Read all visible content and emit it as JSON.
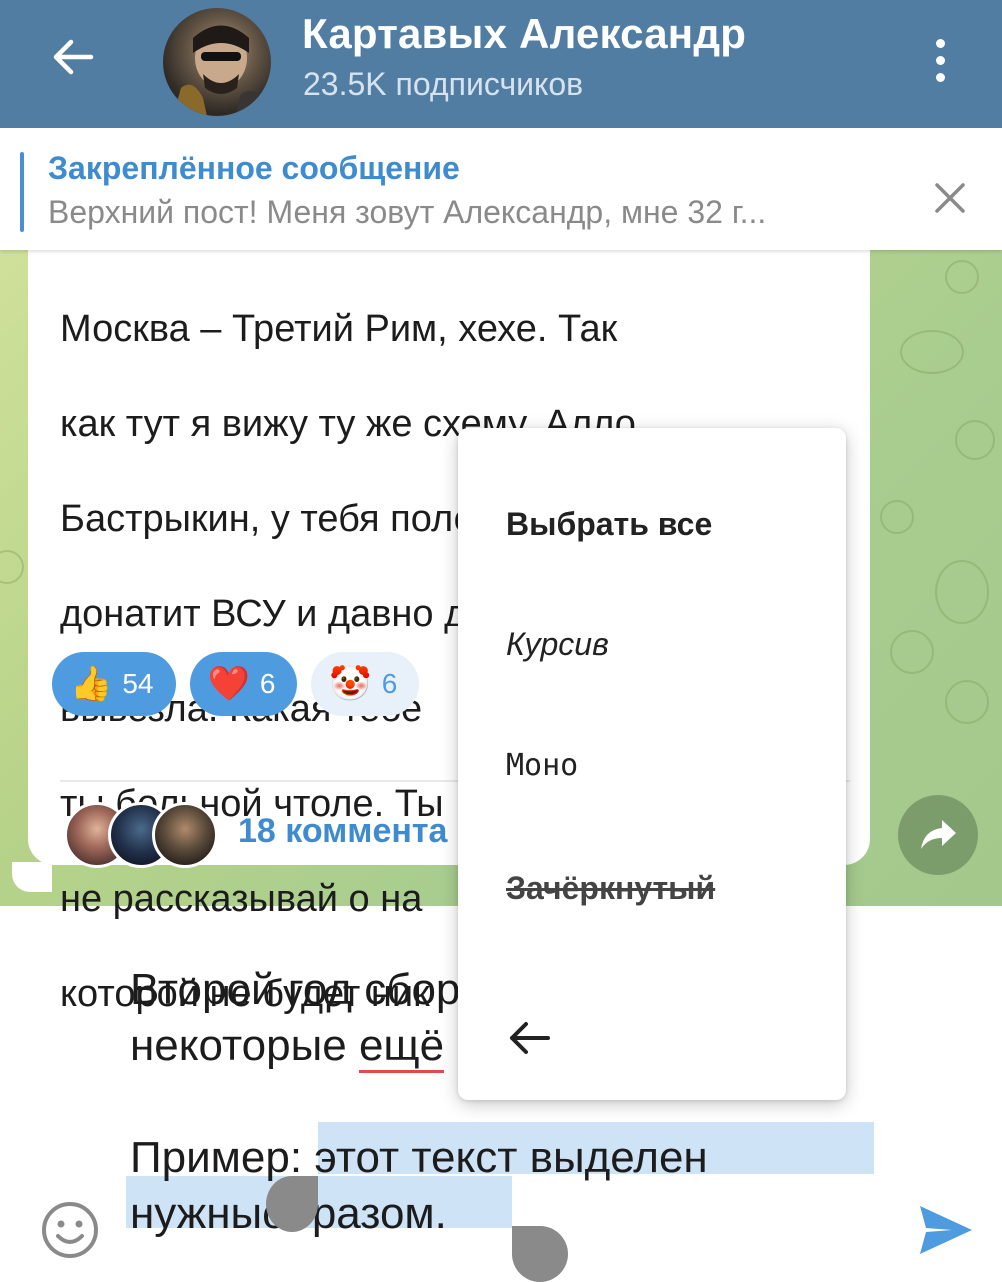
{
  "header": {
    "title": "Картавых Александр",
    "subtitle": "23.5K подписчиков",
    "back_icon": "arrow-left-icon",
    "menu_icon": "more-vertical-icon"
  },
  "pinned": {
    "title": "Закреплённое сообщение",
    "text": "Верхний пост!  Меня зовут Александр, мне 32 г...",
    "close_icon": "close-icon"
  },
  "message": {
    "lines": [
      "Москва – Третий Рим, хехе. Так",
      "как тут я вижу ту же схему. Алло,",
      "Бастрыкин, у тебя половина олигархов",
      "донатит ВСУ и давно детей за границу",
      "вывезла. Какая тебе",
      "ты больной чтоле. Ты",
      "не рассказывай о на",
      "которой не будет ник"
    ],
    "reactions": [
      {
        "emoji": "👍",
        "count": "54"
      },
      {
        "emoji": "❤️",
        "count": "6"
      },
      {
        "emoji": "🤡",
        "count": "6"
      }
    ],
    "comments_label": "18 коммента"
  },
  "composer": {
    "line1": "Второй год сбор",
    "line2_a": "некоторые ",
    "line2_b": "ещё",
    "line3_a": "Пример: ",
    "line3_b": "этот текст выделен",
    "line4_a": "нужны",
    "line4_b": "образом."
  },
  "context_menu": {
    "bold": "Выбрать все",
    "italic": "Курсив",
    "mono": "Моно",
    "strike": "Зачёркнутый",
    "back_icon": "arrow-left-icon"
  },
  "colors": {
    "header": "#527da3",
    "accent": "#3f8bd0",
    "selection": "#cfe3f7"
  }
}
